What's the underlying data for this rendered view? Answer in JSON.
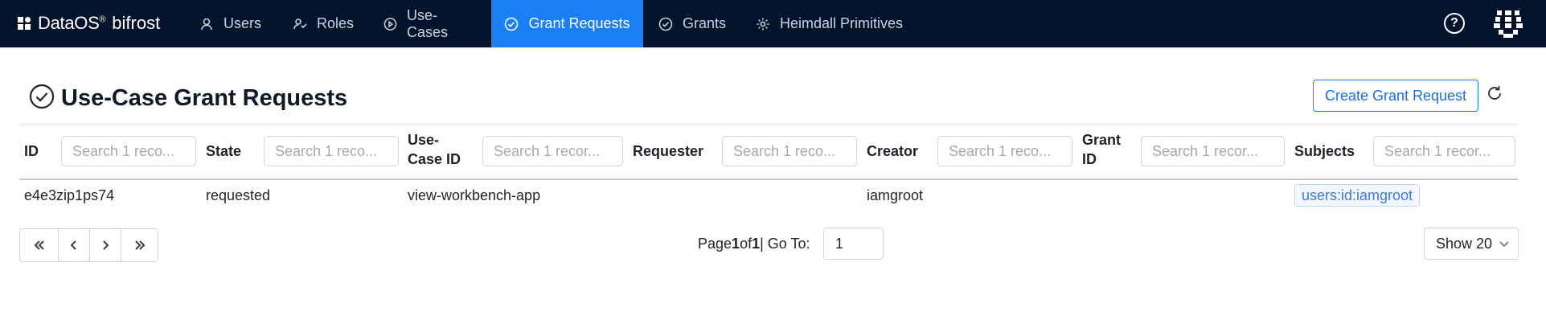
{
  "brand": {
    "name": "DataOS",
    "registered": "®",
    "product": "bifrost"
  },
  "nav": {
    "tabs": [
      {
        "label": "Users",
        "icon": "user-icon"
      },
      {
        "label": "Roles",
        "icon": "roles-icon"
      },
      {
        "label": "Use-Cases",
        "icon": "play-circle-icon"
      },
      {
        "label": "Grant Requests",
        "icon": "check-circle-icon",
        "active": true
      },
      {
        "label": "Grants",
        "icon": "check-circle-icon"
      },
      {
        "label": "Heimdall Primitives",
        "icon": "gear-icon"
      }
    ],
    "help_label": "?"
  },
  "page": {
    "title": "Use-Case Grant Requests",
    "create_button": "Create Grant Request"
  },
  "table": {
    "columns": [
      {
        "label": "ID",
        "placeholder": "Search 1 reco..."
      },
      {
        "label": "State",
        "placeholder": "Search 1 reco..."
      },
      {
        "label_line1": "Use-",
        "label_line2": "Case ID",
        "placeholder": "Search 1 recor..."
      },
      {
        "label": "Requester",
        "placeholder": "Search 1 reco..."
      },
      {
        "label": "Creator",
        "placeholder": "Search 1 reco..."
      },
      {
        "label_line1": "Grant",
        "label_line2": "ID",
        "placeholder": "Search 1 recor..."
      },
      {
        "label": "Subjects",
        "placeholder": "Search 1 recor..."
      }
    ],
    "rows": [
      {
        "id": "e4e3zip1ps74",
        "state": "requested",
        "use_case_id": "view-workbench-app",
        "requester": "",
        "creator": "iamgroot",
        "grant_id": "",
        "subjects": [
          "users:id:iamgroot"
        ]
      }
    ]
  },
  "pagination": {
    "page_label": "Page",
    "current": "1",
    "of_label": "of",
    "total": "1",
    "goto_label": "| Go To:",
    "goto_value": "1",
    "show_label": "Show 20"
  },
  "colors": {
    "nav_bg": "#03132b",
    "accent": "#1a7ef5"
  }
}
